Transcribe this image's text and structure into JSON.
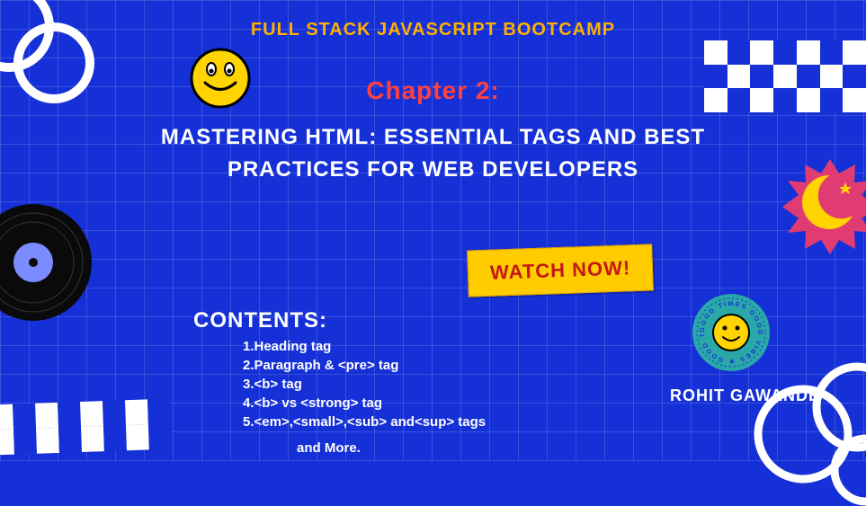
{
  "subtitle": "FULL STACK JAVASCRIPT BOOTCAMP",
  "chapter": "Chapter 2:",
  "title_line1": "MASTERING HTML: ESSENTIAL TAGS AND BEST",
  "title_line2": "PRACTICES FOR WEB DEVELOPERS",
  "watch_label": "WATCH NOW!",
  "contents_heading": "CONTENTS:",
  "contents_items": {
    "i1": "1.Heading tag",
    "i2": "2.Paragraph & <pre> tag",
    "i3": "3.<b> tag",
    "i4": "4.<b> vs <strong> tag",
    "i5": "5.<em>,<small>,<sub> and<sup> tags"
  },
  "and_more": "and More.",
  "author": "ROHIT GAWANDE",
  "badge_text": "GOOD TIMES GOOD VIBES"
}
